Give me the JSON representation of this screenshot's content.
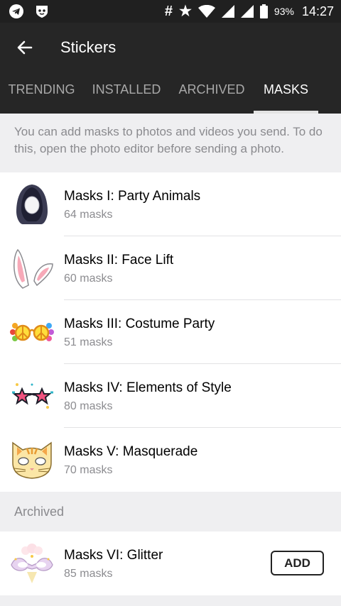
{
  "status_bar": {
    "icons": [
      "telegram-icon",
      "vpn-mask-icon",
      "hash-icon",
      "star-icon",
      "wifi-icon",
      "signal-icon",
      "signal-icon",
      "battery-icon"
    ],
    "hash": "#",
    "star": "★",
    "battery_percent": "93%",
    "time": "14:27"
  },
  "header": {
    "back_icon": "arrow-left-icon",
    "title": "Stickers"
  },
  "tabs": [
    {
      "label": "TRENDING"
    },
    {
      "label": "INSTALLED"
    },
    {
      "label": "ARCHIVED"
    },
    {
      "label": "MASKS",
      "active": true
    }
  ],
  "info_text": "You can add masks to photos and videos you send. To do this, open the photo editor before sending a photo.",
  "mask_sets": [
    {
      "name": "Masks I: Party Animals",
      "count": "64 masks",
      "icon": "hood-mask-icon"
    },
    {
      "name": "Masks II: Face Lift",
      "count": "60 masks",
      "icon": "bunny-ears-icon"
    },
    {
      "name": "Masks III: Costume Party",
      "count": "51 masks",
      "icon": "peace-glasses-icon"
    },
    {
      "name": "Masks IV: Elements of Style",
      "count": "80 masks",
      "icon": "star-glasses-icon"
    },
    {
      "name": "Masks V: Masquerade",
      "count": "70 masks",
      "icon": "cat-mask-icon"
    }
  ],
  "archived_section": {
    "title": "Archived",
    "items": [
      {
        "name": "Masks VI: Glitter",
        "count": "85 masks",
        "icon": "glitter-mask-icon",
        "action": "ADD"
      }
    ]
  },
  "colors": {
    "status_bar": "#202020",
    "app_bar": "#262626",
    "background": "#efeff1",
    "secondary_text": "#8a8a8e"
  }
}
